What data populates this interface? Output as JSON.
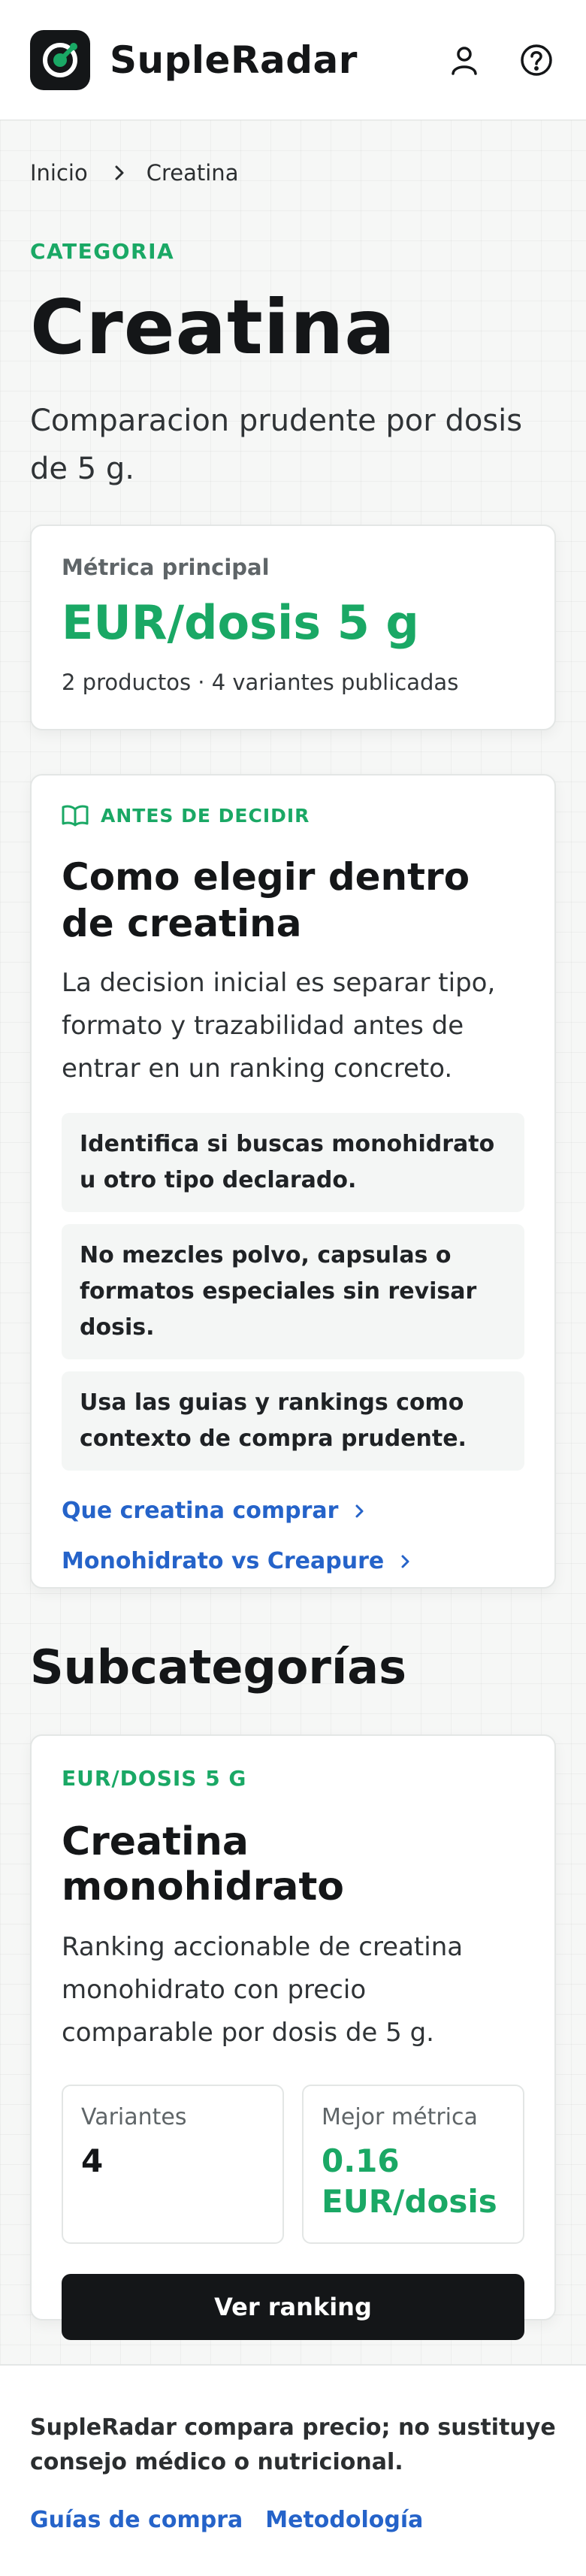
{
  "header": {
    "brand": "SupleRadar",
    "logo_icon": "radar-logo-icon",
    "actions": [
      "user-icon",
      "help-icon"
    ]
  },
  "breadcrumb": {
    "items": [
      "Inicio",
      "Creatina"
    ]
  },
  "category": {
    "eyebrow": "CATEGORIA",
    "title": "Creatina",
    "lead": "Comparacion prudente por dosis de 5 g."
  },
  "metric": {
    "label": "Métrica principal",
    "value": "EUR/dosis 5 g",
    "summary": "2 productos · 4 variantes publicadas"
  },
  "guide": {
    "eyebrow": "ANTES DE DECIDIR",
    "title": "Como elegir dentro de creatina",
    "text": "La decision inicial es separar tipo, formato y trazabilidad antes de entrar en un ranking concreto.",
    "tips": [
      "Identifica si buscas monohidrato u otro tipo declarado.",
      "No mezcles polvo, capsulas o formatos especiales sin revisar dosis.",
      "Usa las guias y rankings como contexto de compra prudente."
    ],
    "links": [
      "Que creatina comprar",
      "Monohidrato vs Creapure"
    ]
  },
  "subcategories": {
    "title": "Subcategorías",
    "items": [
      {
        "eyebrow": "EUR/DOSIS 5 G",
        "title": "Creatina monohidrato",
        "description": "Ranking accionable de creatina monohidrato con precio comparable por dosis de 5 g.",
        "stats": [
          {
            "label": "Variantes",
            "value": "4"
          },
          {
            "label": "Mejor métrica",
            "value": "0.16 EUR/dosis"
          }
        ],
        "cta": "Ver ranking"
      }
    ]
  },
  "footer": {
    "note": "SupleRadar compara precio; no sustituye consejo médico o nutricional.",
    "links": [
      "Guías de compra",
      "Metodología"
    ]
  },
  "colors": {
    "accent_green": "#1aa865",
    "link_blue": "#2563c9",
    "dark": "#141618"
  }
}
